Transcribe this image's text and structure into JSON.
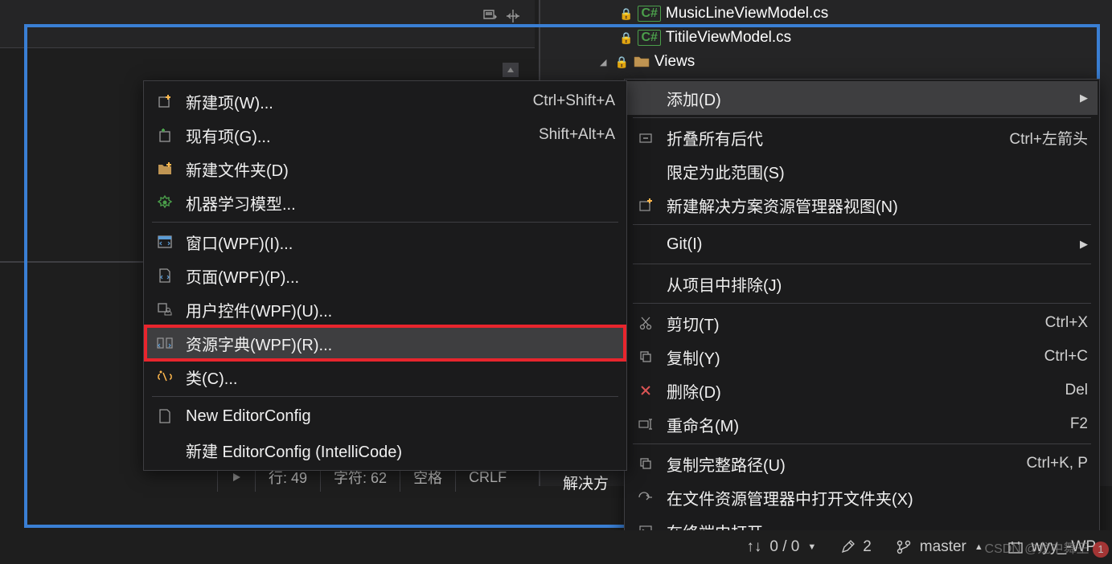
{
  "solution_explorer": {
    "items": [
      {
        "name": "MusicLineViewModel.cs",
        "type": "cs",
        "locked": true
      },
      {
        "name": "TitileViewModel.cs",
        "type": "cs",
        "locked": true
      },
      {
        "name": "Views",
        "type": "folder",
        "locked": true,
        "expanded": true
      }
    ],
    "bottom_label": "解决方"
  },
  "editor_status": {
    "line": "行: 49",
    "char": "字符: 62",
    "space": "空格",
    "crlf": "CRLF"
  },
  "submenu": {
    "items": [
      {
        "icon": "new-item",
        "label": "新建项(W)...",
        "shortcut": "Ctrl+Shift+A"
      },
      {
        "icon": "existing-item",
        "label": "现有项(G)...",
        "shortcut": "Shift+Alt+A"
      },
      {
        "icon": "new-folder",
        "label": "新建文件夹(D)",
        "shortcut": ""
      },
      {
        "icon": "ml-model",
        "label": "机器学习模型...",
        "shortcut": ""
      }
    ],
    "items2": [
      {
        "icon": "wpf-window",
        "label": "窗口(WPF)(I)...",
        "shortcut": ""
      },
      {
        "icon": "wpf-page",
        "label": "页面(WPF)(P)...",
        "shortcut": ""
      },
      {
        "icon": "wpf-usercontrol",
        "label": "用户控件(WPF)(U)...",
        "shortcut": ""
      },
      {
        "icon": "wpf-resource",
        "label": "资源字典(WPF)(R)...",
        "shortcut": "",
        "red": true,
        "highlighted": true
      },
      {
        "icon": "class",
        "label": "类(C)...",
        "shortcut": ""
      }
    ],
    "items3": [
      {
        "icon": "file",
        "label": "New EditorConfig",
        "shortcut": ""
      },
      {
        "icon": "",
        "label": "新建 EditorConfig (IntelliCode)",
        "shortcut": ""
      }
    ]
  },
  "context_menu": {
    "items": [
      {
        "icon": "",
        "label": "添加(D)",
        "shortcut": "",
        "submenu": true,
        "highlighted": true
      },
      {
        "sep": true
      },
      {
        "icon": "collapse",
        "label": "折叠所有后代",
        "shortcut": "Ctrl+左箭头"
      },
      {
        "icon": "",
        "label": "限定为此范围(S)",
        "shortcut": ""
      },
      {
        "icon": "new-view",
        "label": "新建解决方案资源管理器视图(N)",
        "shortcut": ""
      },
      {
        "sep": true
      },
      {
        "icon": "",
        "label": "Git(I)",
        "shortcut": "",
        "submenu": true
      },
      {
        "sep": true
      },
      {
        "icon": "",
        "label": "从项目中排除(J)",
        "shortcut": ""
      },
      {
        "sep": true
      },
      {
        "icon": "cut",
        "label": "剪切(T)",
        "shortcut": "Ctrl+X"
      },
      {
        "icon": "copy",
        "label": "复制(Y)",
        "shortcut": "Ctrl+C"
      },
      {
        "icon": "delete",
        "label": "删除(D)",
        "shortcut": "Del"
      },
      {
        "icon": "rename",
        "label": "重命名(M)",
        "shortcut": "F2"
      },
      {
        "sep": true
      },
      {
        "icon": "copy-path",
        "label": "复制完整路径(U)",
        "shortcut": "Ctrl+K, P"
      },
      {
        "icon": "open-folder",
        "label": "在文件资源管理器中打开文件夹(X)",
        "shortcut": ""
      },
      {
        "icon": "terminal",
        "label": "在终端中打开",
        "shortcut": ""
      }
    ]
  },
  "status_bar": {
    "change_updown": "↑↓",
    "changes": "0 / 0",
    "edits": "2",
    "branch": "master",
    "project": "wyy_-WP"
  },
  "watermark": "CSDN @龙中舞王",
  "watermark_badge": "1"
}
